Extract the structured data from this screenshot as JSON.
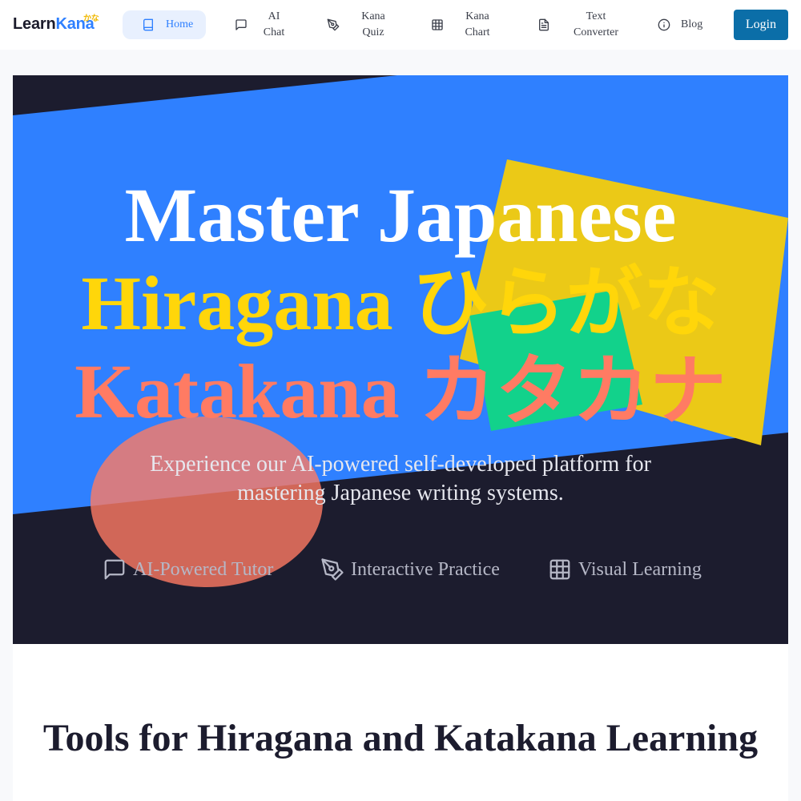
{
  "logo": {
    "part1": "Learn",
    "part2": "Kana",
    "superscript": "かな"
  },
  "nav": {
    "home": "Home",
    "ai_chat": [
      "AI",
      "Chat"
    ],
    "kana_quiz": [
      "Kana",
      "Quiz"
    ],
    "kana_chart": [
      "Kana",
      "Chart"
    ],
    "text_converter": [
      "Text",
      "Converter"
    ],
    "blog": "Blog",
    "login": "Login"
  },
  "hero": {
    "line1": "Master Japanese",
    "line2": "Hiragana ひらがな",
    "line3": "Katakana カタカナ",
    "subtitle_line1": "Experience our AI-powered self-developed platform for",
    "subtitle_line2": "mastering Japanese writing systems.",
    "features": [
      {
        "label": "AI-Powered Tutor",
        "icon": "message-square-icon"
      },
      {
        "label": "Interactive Practice",
        "icon": "pen-tool-icon"
      },
      {
        "label": "Visual Learning",
        "icon": "grid-table-icon"
      }
    ]
  },
  "section": {
    "title": "Tools for Hiragana and Katakana Learning"
  },
  "colors": {
    "accent_blue": "#2f80ff",
    "hero_dark": "#1c1c2e",
    "yellow": "#ffd60a",
    "coral": "#ff7b63",
    "login_blue": "#0b6ea8"
  }
}
